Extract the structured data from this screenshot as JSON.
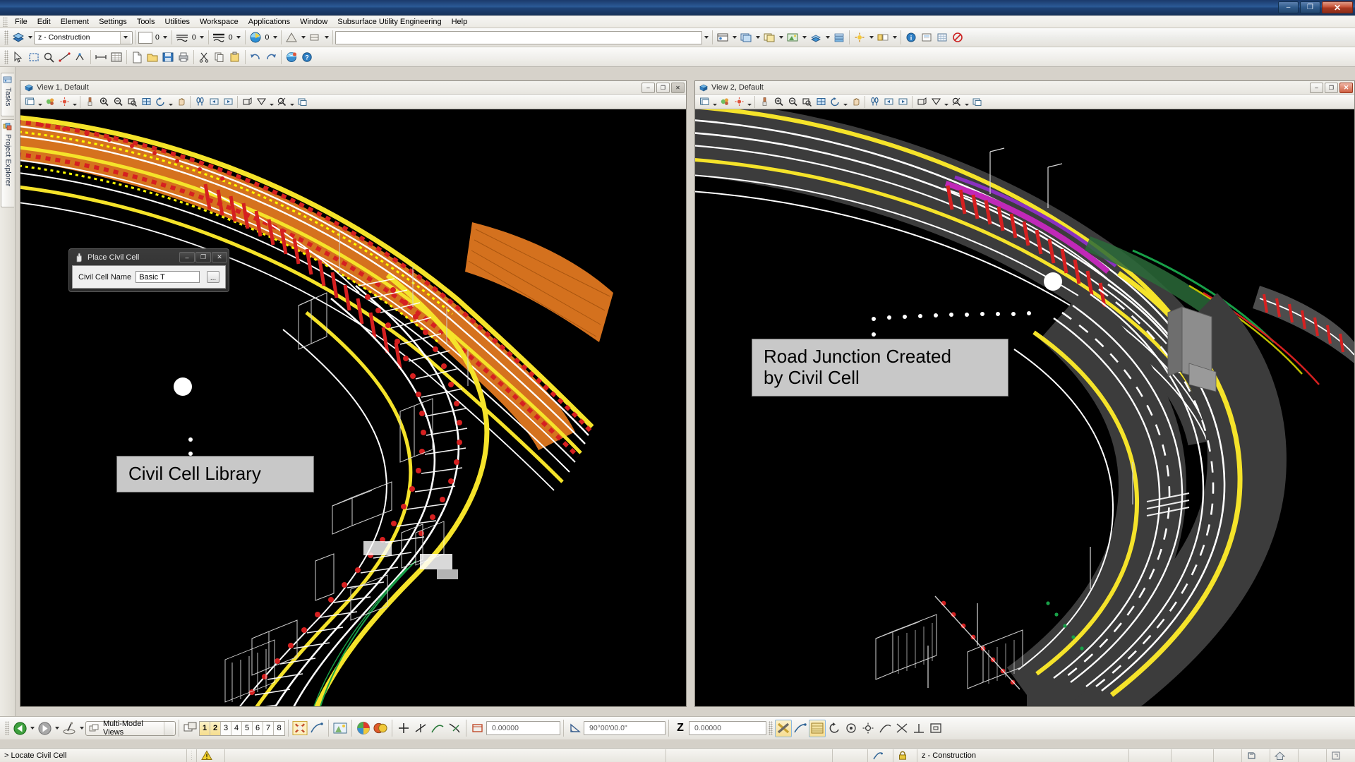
{
  "app": {
    "title": "",
    "window_controls": {
      "minimize": "–",
      "restore": "❐",
      "close": "✕"
    }
  },
  "menubar": {
    "items": [
      {
        "label": "File"
      },
      {
        "label": "Edit"
      },
      {
        "label": "Element"
      },
      {
        "label": "Settings"
      },
      {
        "label": "Tools"
      },
      {
        "label": "Utilities"
      },
      {
        "label": "Workspace"
      },
      {
        "label": "Applications"
      },
      {
        "label": "Window"
      },
      {
        "label": "Subsurface Utility Engineering"
      },
      {
        "label": "Help"
      }
    ]
  },
  "toolbar": {
    "level_combo": "z - Construction",
    "color_value": "0",
    "style_value": "0",
    "weight_value": "0",
    "class_value": "0",
    "input_field_value": ""
  },
  "left_rail": {
    "tabs": [
      {
        "label": "Tasks",
        "icon": "tasks-icon"
      },
      {
        "label": "Project Explorer",
        "icon": "project-explorer-icon"
      }
    ]
  },
  "views": [
    {
      "id": "view1",
      "title": "View 1, Default",
      "icon": "view-cube-icon",
      "active": false,
      "buttons": {
        "minimize": "–",
        "restore": "❐",
        "close": "✕"
      }
    },
    {
      "id": "view2",
      "title": "View 2, Default",
      "icon": "view-cube-icon",
      "active": true,
      "buttons": {
        "minimize": "–",
        "restore": "❐",
        "close": "✕"
      }
    }
  ],
  "dialog": {
    "title": "Place Civil Cell",
    "icon": "hand-pointer-icon",
    "field_label": "Civil Cell Name",
    "field_value": "Basic T",
    "browse_label": "...",
    "buttons": {
      "minimize": "–",
      "restore": "❐",
      "close": "✕"
    }
  },
  "callouts": [
    {
      "id": "callout-left",
      "lines": [
        "Civil Cell Library"
      ]
    },
    {
      "id": "callout-right",
      "lines": [
        "Road Junction Created",
        "by Civil Cell"
      ]
    }
  ],
  "bottom_toolbar": {
    "view_selector": "Multi-Model Views",
    "view_numbers": [
      {
        "num": "1",
        "on": true
      },
      {
        "num": "2",
        "on": true
      },
      {
        "num": "3",
        "on": false
      },
      {
        "num": "4",
        "on": false
      },
      {
        "num": "5",
        "on": false
      },
      {
        "num": "6",
        "on": false
      },
      {
        "num": "7",
        "on": false
      },
      {
        "num": "8",
        "on": false
      }
    ],
    "distance_value": "0.00000",
    "angle_value": "90°00'00.0\"",
    "z_label": "Z",
    "z_value": "0.00000"
  },
  "statusbar": {
    "message": "> Locate Civil Cell",
    "alert_icon": "warning-icon",
    "level": "z - Construction",
    "snap_icon": "snap-icon",
    "lock_icon": "lock-icon"
  },
  "colors": {
    "title_blue": "#1d4276",
    "close_red": "#c75338",
    "canvas_black": "#000000",
    "callout_gray": "#c8c8c8",
    "road_yellow": "#f5e32a",
    "road_red": "#d62020",
    "road_white": "#ffffff",
    "road_orange": "#e07820",
    "road_asphalt": "#3a3a3a",
    "road_magenta": "#c028b8",
    "road_green": "#18a048"
  }
}
